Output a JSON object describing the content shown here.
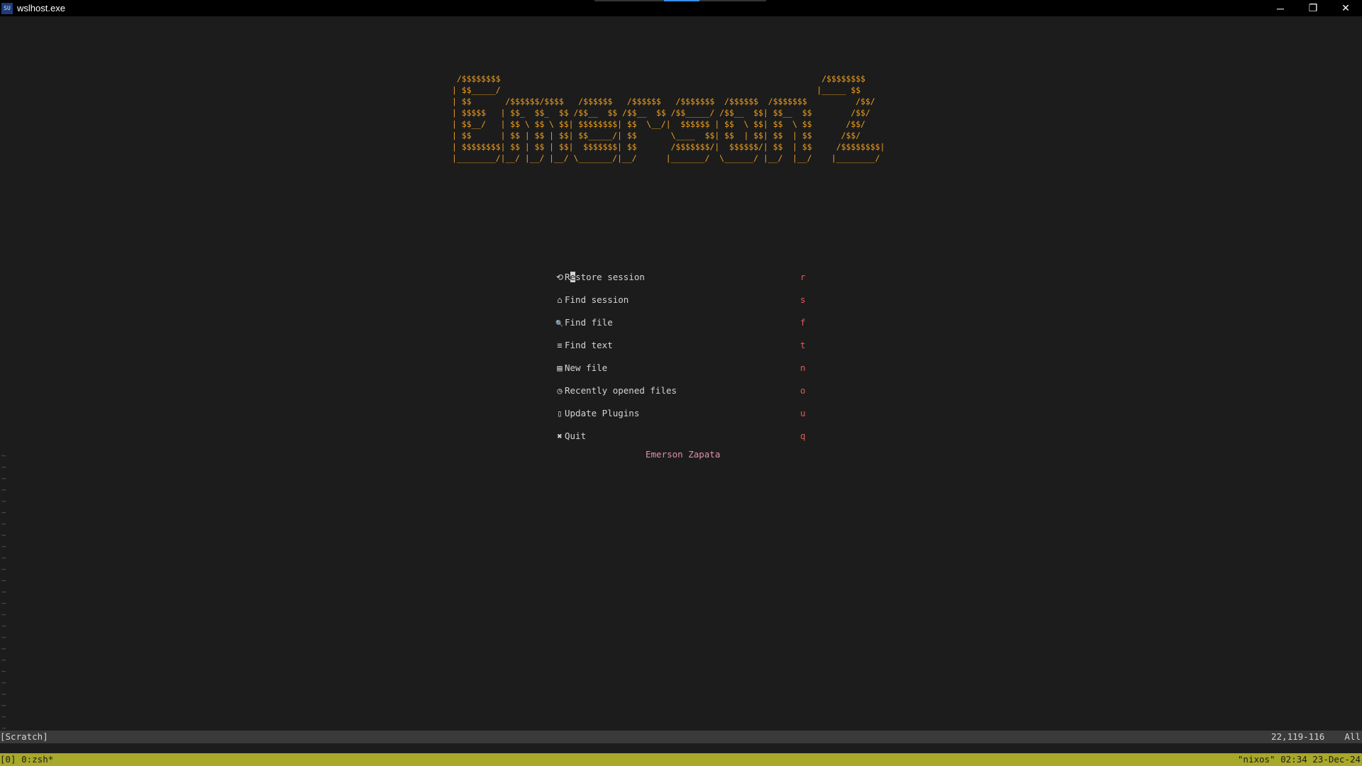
{
  "window": {
    "title": "wslhost.exe",
    "icon_text": "SU",
    "controls": {
      "minimize_icon": "─",
      "restore_icon": "❐",
      "close_icon": "✕"
    }
  },
  "dashboard": {
    "banner": [
      " /$$$$$$$$                                                                  /$$$$$$$$",
      "| $$_____/                                                                 |_____ $$",
      "| $$       /$$$$$$/$$$$   /$$$$$$   /$$$$$$   /$$$$$$$  /$$$$$$  /$$$$$$$          /$$/",
      "| $$$$$   | $$_  $$_  $$ /$$__  $$ /$$__  $$ /$$_____/ /$$__  $$| $$__  $$        /$$/",
      "| $$__/   | $$ \\ $$ \\ $$| $$$$$$$$| $$  \\__/|  $$$$$$ | $$  \\ $$| $$  \\ $$       /$$/",
      "| $$      | $$ | $$ | $$| $$_____/| $$       \\____  $$| $$  | $$| $$  | $$      /$$/",
      "| $$$$$$$$| $$ | $$ | $$|  $$$$$$$| $$       /$$$$$$$/|  $$$$$$/| $$  | $$     /$$$$$$$$|",
      "|________/|__/ |__/ |__/ \\_______/|__/      |_______/  \\______/ |__/  |__/    |________/"
    ],
    "items": [
      {
        "icon": "⟲",
        "label_first": "R",
        "label_cursor": "e",
        "label_rest": "store session",
        "key": "r",
        "icon_name": "restore-icon"
      },
      {
        "icon": "⌂",
        "label": "Find session",
        "key": "s",
        "icon_name": "session-icon"
      },
      {
        "icon": "🔍",
        "label": "Find file",
        "key": "f",
        "icon_name": "file-search-icon"
      },
      {
        "icon": "≡",
        "label": "Find text",
        "key": "t",
        "icon_name": "text-search-icon"
      },
      {
        "icon": "▤",
        "label": "New file",
        "key": "n",
        "icon_name": "new-file-icon"
      },
      {
        "icon": "◷",
        "label": "Recently opened files",
        "key": "o",
        "icon_name": "clock-icon"
      },
      {
        "icon": "▯",
        "label": "Update Plugins",
        "key": "u",
        "icon_name": "plugin-icon"
      },
      {
        "icon": "✖",
        "label": "Quit",
        "key": "q",
        "icon_name": "quit-icon"
      }
    ],
    "footer": "Emerson Zapata"
  },
  "statusline": {
    "buffer": "[Scratch]",
    "position": "22,119-116",
    "scroll": "All"
  },
  "tmux": {
    "left": "[0] 0:zsh*",
    "right": "\"nixos\" 02:34 23-Dec-24"
  },
  "colors": {
    "background": "#1c1c1c",
    "banner": "#f0a020",
    "keys": "#e05a5a",
    "footer": "#e08fb0",
    "tmux_bar": "#a8a82a"
  }
}
